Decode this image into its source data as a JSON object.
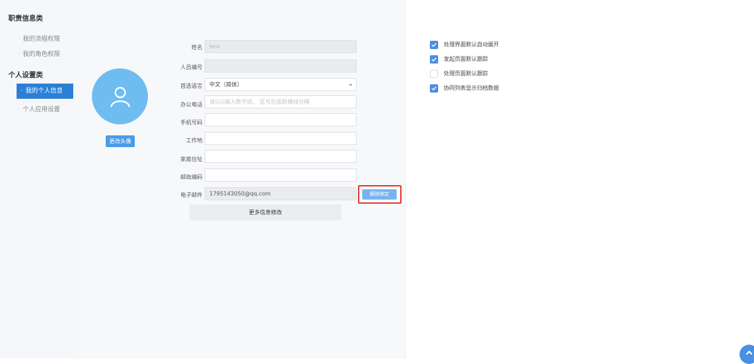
{
  "sidebar": {
    "group1_title": "职责信息类",
    "group1_items": [
      "我的流程权限",
      "我的角色权限"
    ],
    "group2_title": "个人设置类",
    "group2_items": [
      "我的个人信息",
      "个人应用设置"
    ]
  },
  "profile": {
    "avatar_button": "更改头像",
    "fields": {
      "name": {
        "label": "姓名",
        "value": "test"
      },
      "staff_no": {
        "label": "人员编号",
        "value": ""
      },
      "language": {
        "label": "首选语言",
        "value": "中文（简体）"
      },
      "office_phone": {
        "label": "办公电话",
        "placeholder": "请以G输入数字组，  区号后面跟横线分隔"
      },
      "mobile": {
        "label": "手机号码",
        "value": ""
      },
      "workplace": {
        "label": "工作地",
        "value": ""
      },
      "home_address": {
        "label": "家庭住址",
        "value": ""
      },
      "postcode": {
        "label": "邮政编码",
        "value": ""
      },
      "email": {
        "label": "电子邮件",
        "value": "1795143050@qq.com"
      }
    },
    "unbind_button": "解除绑定",
    "more_button": "更多信息修改"
  },
  "settings": {
    "options": [
      {
        "label": "处理界面默认自动展开",
        "checked": true
      },
      {
        "label": "发起页面默认跟踪",
        "checked": true
      },
      {
        "label": "处理页面默认跟踪",
        "checked": false
      },
      {
        "label": "协同列表显示归档数据",
        "checked": true
      }
    ]
  },
  "icons": {
    "avatar": "user-icon",
    "select": "chevron-down-icon",
    "check": "check-icon",
    "scroll_top": "chevron-up-icon"
  },
  "colors": {
    "accent": "#2b7fd6",
    "avatar_bg": "#6ebcf0",
    "checkbox": "#4a90e2",
    "highlight_border": "#e23a3a"
  }
}
